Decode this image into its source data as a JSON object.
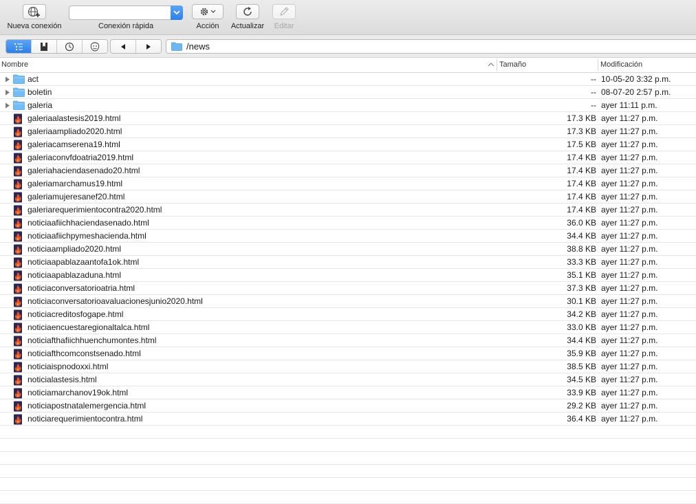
{
  "toolbar": {
    "new_connection_label": "Nueva conexión",
    "quick_connect_label": "Conexión rápida",
    "quick_connect_value": "",
    "action_label": "Acción",
    "refresh_label": "Actualizar",
    "edit_label": "Editar"
  },
  "navigation": {
    "path": "/news",
    "view_modes": [
      "browser",
      "bookmarks",
      "history",
      "bonjour"
    ]
  },
  "columns": {
    "name": "Nombre",
    "size": "Tamaño",
    "modified": "Modificación"
  },
  "files": [
    {
      "type": "folder",
      "name": "act",
      "size": "--",
      "modified": "10-05-20 3:32 p.m."
    },
    {
      "type": "folder",
      "name": "boletin",
      "size": "--",
      "modified": "08-07-20 2:57 p.m."
    },
    {
      "type": "folder",
      "name": "galeria",
      "size": "--",
      "modified": "ayer 11:11 p.m."
    },
    {
      "type": "html",
      "name": "galeriaalastesis2019.html",
      "size": "17.3 KB",
      "modified": "ayer 11:27 p.m."
    },
    {
      "type": "html",
      "name": "galeriaampliado2020.html",
      "size": "17.3 KB",
      "modified": "ayer 11:27 p.m."
    },
    {
      "type": "html",
      "name": "galeriacamserena19.html",
      "size": "17.5 KB",
      "modified": "ayer 11:27 p.m."
    },
    {
      "type": "html",
      "name": "galeriaconvfdoatria2019.html",
      "size": "17.4 KB",
      "modified": "ayer 11:27 p.m."
    },
    {
      "type": "html",
      "name": "galeriahaciendasenado20.html",
      "size": "17.4 KB",
      "modified": "ayer 11:27 p.m."
    },
    {
      "type": "html",
      "name": "galeriamarchamus19.html",
      "size": "17.4 KB",
      "modified": "ayer 11:27 p.m."
    },
    {
      "type": "html",
      "name": "galeriamujeresanef20.html",
      "size": "17.4 KB",
      "modified": "ayer 11:27 p.m."
    },
    {
      "type": "html",
      "name": "galeriarequerimientocontra2020.html",
      "size": "17.4 KB",
      "modified": "ayer 11:27 p.m."
    },
    {
      "type": "html",
      "name": "noticiaafiichhaciendasenado.html",
      "size": "36.0 KB",
      "modified": "ayer 11:27 p.m."
    },
    {
      "type": "html",
      "name": "noticiaafiichpymeshacienda.html",
      "size": "34.4 KB",
      "modified": "ayer 11:27 p.m."
    },
    {
      "type": "html",
      "name": "noticiaampliado2020.html",
      "size": "38.8 KB",
      "modified": "ayer 11:27 p.m."
    },
    {
      "type": "html",
      "name": "noticiaapablazaantofa1ok.html",
      "size": "33.3 KB",
      "modified": "ayer 11:27 p.m."
    },
    {
      "type": "html",
      "name": "noticiaapablazaduna.html",
      "size": "35.1 KB",
      "modified": "ayer 11:27 p.m."
    },
    {
      "type": "html",
      "name": "noticiaconversatorioatria.html",
      "size": "37.3 KB",
      "modified": "ayer 11:27 p.m."
    },
    {
      "type": "html",
      "name": "noticiaconversatorioavaluacionesjunio2020.html",
      "size": "30.1 KB",
      "modified": "ayer 11:27 p.m."
    },
    {
      "type": "html",
      "name": "noticiacreditosfogape.html",
      "size": "34.2 KB",
      "modified": "ayer 11:27 p.m."
    },
    {
      "type": "html",
      "name": "noticiaencuestaregionaltalca.html",
      "size": "33.0 KB",
      "modified": "ayer 11:27 p.m."
    },
    {
      "type": "html",
      "name": "noticiafthafiichhuenchumontes.html",
      "size": "34.4 KB",
      "modified": "ayer 11:27 p.m."
    },
    {
      "type": "html",
      "name": "noticiafthcomconstsenado.html",
      "size": "35.9 KB",
      "modified": "ayer 11:27 p.m."
    },
    {
      "type": "html",
      "name": "noticiaispnodoxxi.html",
      "size": "38.5 KB",
      "modified": "ayer 11:27 p.m."
    },
    {
      "type": "html",
      "name": "noticialastesis.html",
      "size": "34.5 KB",
      "modified": "ayer 11:27 p.m."
    },
    {
      "type": "html",
      "name": "noticiamarchanov19ok.html",
      "size": "33.9 KB",
      "modified": "ayer 11:27 p.m."
    },
    {
      "type": "html",
      "name": "noticiapostnatalemergencia.html",
      "size": "29.2 KB",
      "modified": "ayer 11:27 p.m."
    },
    {
      "type": "html",
      "name": "noticiarequerimientocontra.html",
      "size": "36.4 KB",
      "modified": "ayer 11:27 p.m."
    }
  ],
  "colors": {
    "accent": "#2f80ea",
    "folder": "#6fb7f0",
    "html_icon_bg": "#2b2750",
    "html_icon_flame": "#e8552d"
  }
}
